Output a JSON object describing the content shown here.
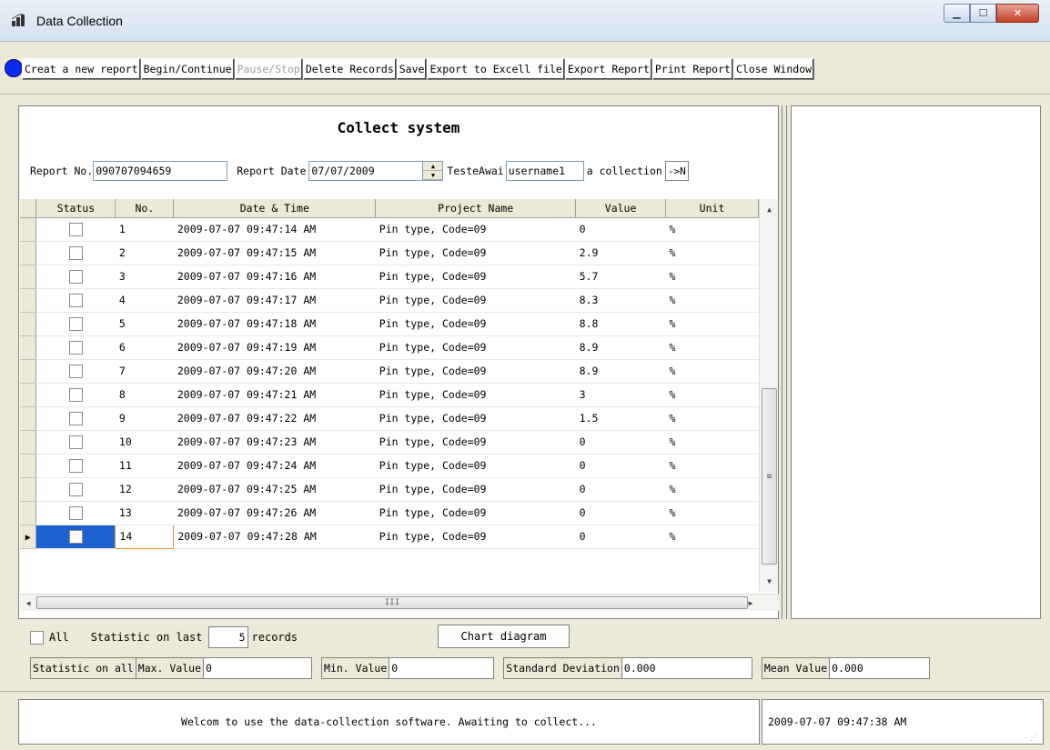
{
  "window": {
    "title": "Data Collection"
  },
  "toolbar": {
    "buttons": [
      {
        "label": "Creat a new report"
      },
      {
        "label": "Begin/Continue"
      },
      {
        "label": "Pause/Stop"
      },
      {
        "label": "Delete Records"
      },
      {
        "label": "Save"
      },
      {
        "label": "Export to Excell file"
      },
      {
        "label": "Export Report"
      },
      {
        "label": "Print Report"
      },
      {
        "label": "Close Window"
      }
    ]
  },
  "panel": {
    "title": "Collect system",
    "report_no_label": "Report No.",
    "report_no": "090707094659",
    "report_date_label": "Report Date",
    "report_date": "07/07/2009",
    "tester_label": "TesteAwai",
    "tester": "username1",
    "collection_label": "a collection",
    "collection_btn": "->N"
  },
  "grid": {
    "columns": [
      "Status",
      "No.",
      "Date & Time",
      "Project Name",
      "Value",
      "Unit"
    ],
    "rows": [
      {
        "no": "1",
        "datetime": "2009-07-07 09:47:14 AM",
        "project": "Pin type, Code=09",
        "value": "0",
        "unit": "%"
      },
      {
        "no": "2",
        "datetime": "2009-07-07 09:47:15 AM",
        "project": "Pin type, Code=09",
        "value": "2.9",
        "unit": "%"
      },
      {
        "no": "3",
        "datetime": "2009-07-07 09:47:16 AM",
        "project": "Pin type, Code=09",
        "value": "5.7",
        "unit": "%"
      },
      {
        "no": "4",
        "datetime": "2009-07-07 09:47:17 AM",
        "project": "Pin type, Code=09",
        "value": "8.3",
        "unit": "%"
      },
      {
        "no": "5",
        "datetime": "2009-07-07 09:47:18 AM",
        "project": "Pin type, Code=09",
        "value": "8.8",
        "unit": "%"
      },
      {
        "no": "6",
        "datetime": "2009-07-07 09:47:19 AM",
        "project": "Pin type, Code=09",
        "value": "8.9",
        "unit": "%"
      },
      {
        "no": "7",
        "datetime": "2009-07-07 09:47:20 AM",
        "project": "Pin type, Code=09",
        "value": "8.9",
        "unit": "%"
      },
      {
        "no": "8",
        "datetime": "2009-07-07 09:47:21 AM",
        "project": "Pin type, Code=09",
        "value": "3",
        "unit": "%"
      },
      {
        "no": "9",
        "datetime": "2009-07-07 09:47:22 AM",
        "project": "Pin type, Code=09",
        "value": "1.5",
        "unit": "%"
      },
      {
        "no": "10",
        "datetime": "2009-07-07 09:47:23 AM",
        "project": "Pin type, Code=09",
        "value": "0",
        "unit": "%"
      },
      {
        "no": "11",
        "datetime": "2009-07-07 09:47:24 AM",
        "project": "Pin type, Code=09",
        "value": "0",
        "unit": "%"
      },
      {
        "no": "12",
        "datetime": "2009-07-07 09:47:25 AM",
        "project": "Pin type, Code=09",
        "value": "0",
        "unit": "%"
      },
      {
        "no": "13",
        "datetime": "2009-07-07 09:47:26 AM",
        "project": "Pin type, Code=09",
        "value": "0",
        "unit": "%"
      },
      {
        "no": "14",
        "datetime": "2009-07-07 09:47:28 AM",
        "project": "Pin type, Code=09",
        "value": "0",
        "unit": "%"
      }
    ],
    "hscroll_glyph": "III",
    "vscroll_glyph": "≡"
  },
  "stats": {
    "all_label": "All",
    "last_label": "Statistic on last",
    "last_count": "5",
    "records_label": "records",
    "chart_button": "Chart diagram",
    "on_all_label": "Statistic on all",
    "max_label": "Max. Value",
    "max_value": "0",
    "min_label": "Min. Value",
    "min_value": "0",
    "std_label": "Standard Deviation",
    "std_value": "0.000",
    "mean_label": "Mean Value",
    "mean_value": "0.000"
  },
  "statusbar": {
    "message": "Welcom to use the data-collection software. Awaiting to collect...",
    "time": "2009-07-07 09:47:38 AM"
  },
  "colors": {
    "accent_dot": "#0a2bef",
    "selection": "#1e62d2"
  }
}
